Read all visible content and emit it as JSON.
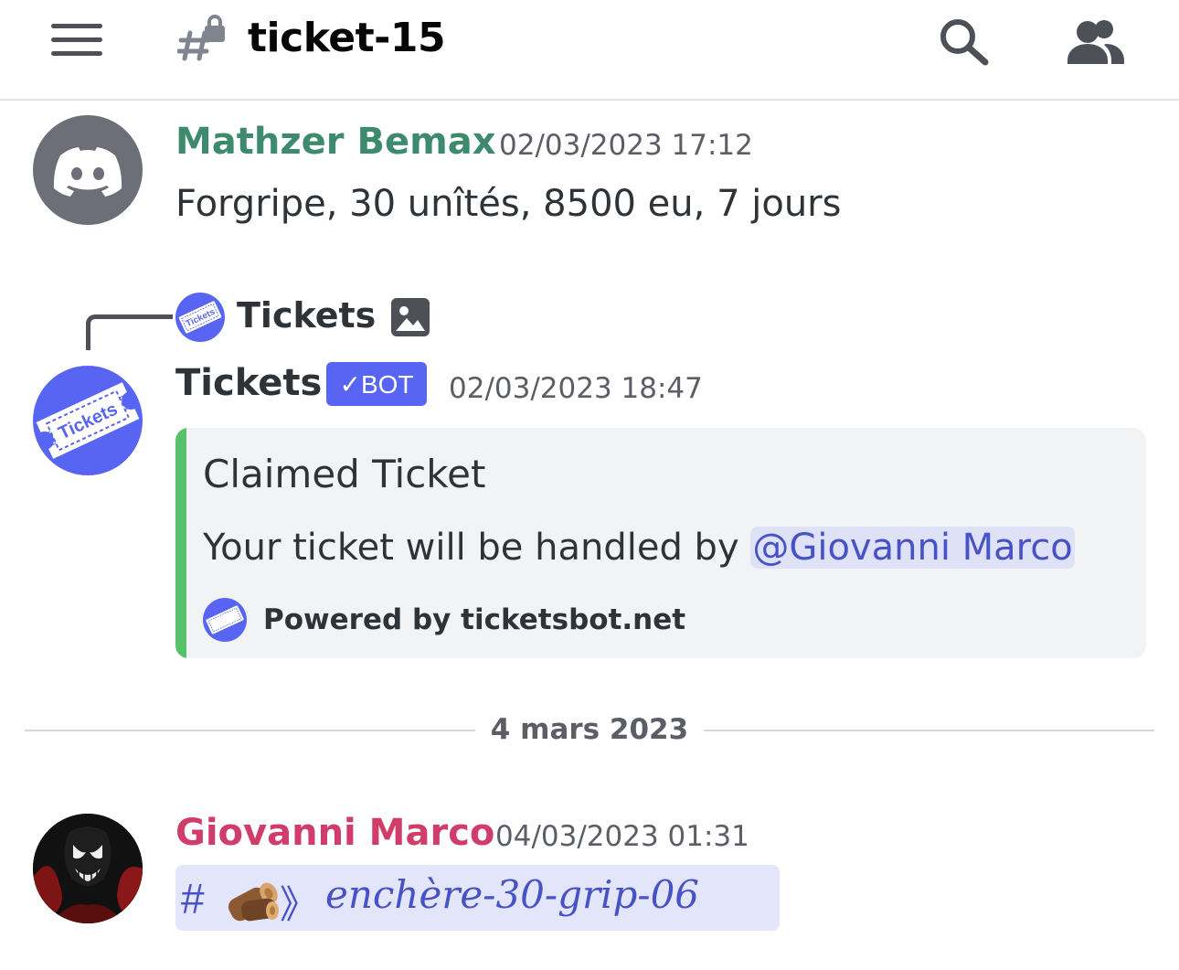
{
  "header": {
    "channel_name": "ticket-15",
    "menu_icon": "hamburger-menu-icon",
    "channel_icon": "locked-hash-icon",
    "search_icon": "search-icon",
    "members_icon": "members-icon"
  },
  "messages": [
    {
      "author": "Mathzer Bemax",
      "author_color": "#3e8a6e",
      "timestamp": "02/03/2023 17:12",
      "content": "Forgripe, 30 unîtés, 8500 eu, 7 jours",
      "avatar": "discord-default-avatar"
    },
    {
      "reply": {
        "author": "Tickets",
        "attachment_icon": "image-icon"
      },
      "author": "Tickets",
      "author_color": "#2e3338",
      "badge": "✓BOT",
      "timestamp": "02/03/2023 18:47",
      "avatar": "tickets-bot-avatar",
      "embed": {
        "accent_color": "#57c26b",
        "title": "Claimed Ticket",
        "description_prefix": "Your ticket will be handled by ",
        "mention": "@Giovanni Marco",
        "footer": "Powered by ticketsbot.net"
      }
    },
    {
      "author": "Giovanni Marco",
      "author_color": "#d13d6b",
      "timestamp": "04/03/2023 01:31",
      "avatar": "user-avatar",
      "channel_mention": {
        "hash": "#",
        "emoji": "🪵",
        "separator": "》",
        "name": "enchère-30-grip-06"
      }
    }
  ],
  "date_divider": "4 mars 2023",
  "bot_logo_text": {
    "main": "Tickets",
    "tag": "BOT"
  }
}
